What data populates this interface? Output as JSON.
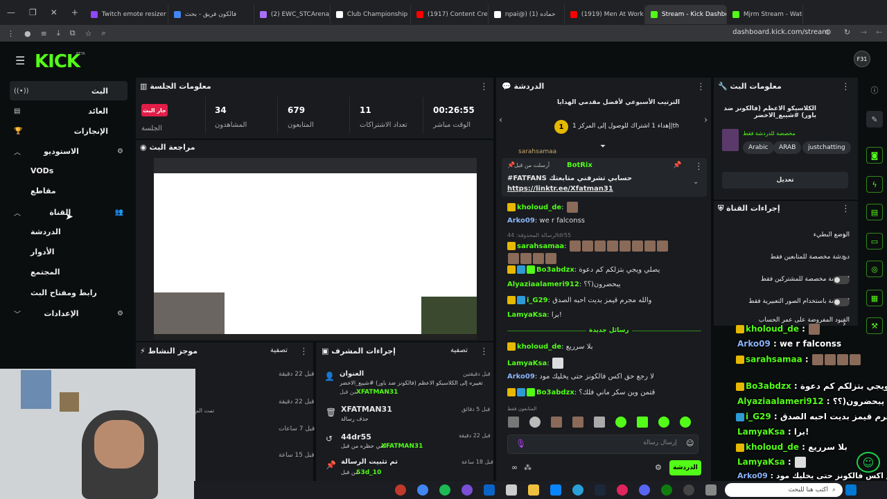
{
  "browser": {
    "tabs": [
      {
        "label": "Twitch emote resizer",
        "color": "#9146ff"
      },
      {
        "label": "فالكون فريق - بحث",
        "color": "#4285f4"
      },
      {
        "label": "(2) EWC_STCArena_A",
        "color": "#a970ff"
      },
      {
        "label": "Club Championship",
        "color": "#ffffff"
      },
      {
        "label": "(1917) Content Creati",
        "color": "#ff0000"
      },
      {
        "label": "npai@) (1) حماده",
        "color": "#ffffff"
      },
      {
        "label": "(1919) Men At Work",
        "color": "#ff0000"
      },
      {
        "label": "Stream - Kick Dashbo",
        "color": "#53fc18"
      },
      {
        "label": "Mjrm Stream - Watc",
        "color": "#53fc18"
      }
    ],
    "url": "dashboard.kick.com/stream"
  },
  "header": {
    "logo": "KICK",
    "logo_sup": "BETA",
    "avatar": "F31"
  },
  "sidebar": {
    "items": [
      {
        "label": "البث"
      },
      {
        "label": "العائد"
      },
      {
        "label": "الإنجازات"
      },
      {
        "label": "الاستوديو"
      },
      {
        "label": "VODs"
      },
      {
        "label": "مقاطع"
      },
      {
        "label": "القناة"
      },
      {
        "label": "الدردشة"
      },
      {
        "label": "الأدوار"
      },
      {
        "label": "المجتمع"
      },
      {
        "label": "رابط ومفتاح البث"
      },
      {
        "label": "الإعدادات"
      }
    ]
  },
  "session": {
    "title": "معلومات الجلسة",
    "live_badge": "جار البث",
    "session_label": "الجلسة",
    "stats": [
      {
        "value": "34",
        "label": "المشاهدون"
      },
      {
        "value": "679",
        "label": "المتابعون"
      },
      {
        "value": "11",
        "label": "تعداد الاشتراكات"
      },
      {
        "value": "00:26:55",
        "label": "الوقت مباشر"
      }
    ]
  },
  "preview": {
    "title": "مراجعة البث"
  },
  "activity": {
    "title": "موجز النشاط",
    "filter": "تصفية",
    "times": [
      "قبل 22 دقيقة",
      "قبل 22 دقيقة",
      "قبل 7 ساعات",
      "قبل 15 ساعة"
    ],
    "snippet": "تمت الم"
  },
  "modlog": {
    "title": "إجراءات المشرف",
    "filter": "تصفية",
    "items": [
      {
        "title": "العنوان",
        "desc": "تم تغييره إلى الكلاسيكو الاعظم (فالكونز ضد باور) #شيبع_الاخضر",
        "by": "XFATMAN31",
        "suffix": "من قبل",
        "time": "قبل دقيقتين"
      },
      {
        "title": "XFATMAN31",
        "desc": "حذف رسالة",
        "time": "قبل 5 دقائق"
      },
      {
        "title": "44dr55",
        "desc": "الغي حظره من قبل",
        "by": "XFATMAN31",
        "time": "قبل 22 دقيقة"
      },
      {
        "title": "تم تثبيت الرسالة",
        "desc": "من قبل",
        "by": "S3d_10",
        "time": "قبل 18 ساعة"
      }
    ]
  },
  "chat": {
    "title": "الدردشة",
    "leaderboard_title": "الترتيب الأسبوعي لأفضل مقدمي الهدايا",
    "leaderboard_rank": "1",
    "leaderboard_text": "إهداء 1 اشتراك للوصول إلى المركز 1|th",
    "pinned_by": "أرسلت من قبل",
    "pinned_user": "BotRix",
    "pinned_text": "#FATFANS حسابي تشرفني متابعتك",
    "pinned_link": "https://linktr.ee/Xfatman31",
    "top_user": "sarahsamaa",
    "messages": [
      {
        "user": "kholoud_de",
        "color": "#53fc18",
        "text": ""
      },
      {
        "user": "Arko09",
        "color": "#8ab4f8",
        "text": "we r falconss"
      },
      {
        "user": "sarahsamaa",
        "color": "#53fc18",
        "text": ""
      },
      {
        "user": "Bo3abdzx",
        "color": "#53fc18",
        "text": "يصلي ويجي بتزلكم كم دعوة"
      },
      {
        "user": "Alyaziaalameri912",
        "color": "#53fc18",
        "text": "يبحضرون(؟؟"
      },
      {
        "user": "i_G29",
        "color": "#53fc18",
        "text": "والله مجرم قيمز بديت احبه الصدق"
      },
      {
        "user": "LamyaKsa",
        "color": "#53fc18",
        "text": "برا!"
      },
      {
        "user": "kholoud_de",
        "color": "#53fc18",
        "text": "بلا سرريع"
      },
      {
        "user": "LamyaKsa",
        "color": "#53fc18",
        "text": ""
      },
      {
        "user": "Arko09",
        "color": "#8ab4f8",
        "text": "لا رجع حق اكس فالكونز حتى يخليك مود"
      },
      {
        "user": "Bo3abdzx",
        "color": "#53fc18",
        "text": "قتمن وين سكر ماني فلك؟"
      }
    ],
    "deleted_text": "الرسالة المحذوفة: 44dr55",
    "new_messages": "رسائل جديدة",
    "followers_only": "المتابعون فقط",
    "input_placeholder": "إرسال رسالة",
    "send_label": "الدردشة"
  },
  "stream_info": {
    "title_label": "معلومات البث",
    "stream_title": "الكلاسيكو الاعظم (فالكونز ضد باور) #شيبع_الاخضر",
    "category_link": "مخصصة للدردشة فقط",
    "tags": [
      "Arabic",
      "ARAB",
      "justchatting"
    ],
    "edit": "تعديل"
  },
  "channel_actions": {
    "title": "إجراءات القناة",
    "rows": [
      {
        "label": "الوضع البطيء",
        "kind": "chevron"
      },
      {
        "label": "دردشة مخصصة للمتابعين فقط",
        "kind": "chevron"
      },
      {
        "label": "الدردشة مخصصة للمشتركين فقط",
        "kind": "toggle"
      },
      {
        "label": "الدردشة باستخدام الصور التعبيرية فقط",
        "kind": "toggle"
      },
      {
        "label": "القيود المفروضة على عمر الحساب",
        "kind": "chevron"
      }
    ]
  },
  "overlay_chat": [
    {
      "user": "kholoud_de",
      "text": ""
    },
    {
      "user": "Arko09",
      "text": "we r falconss"
    },
    {
      "user": "sarahsamaa",
      "text": ""
    },
    {
      "user": "Bo3abdzx",
      "text": "يصلي ويجي بتزلكم كم دعوة"
    },
    {
      "user": "Alyaziaalameri912",
      "text": "يبحضرون(؟؟"
    },
    {
      "user": "i_G29",
      "text": "والله مجرم قيمز بديت احبه الصدق"
    },
    {
      "user": "LamyaKsa",
      "text": "برا!"
    },
    {
      "user": "kholoud_de",
      "text": "بلا سرريع"
    },
    {
      "user": "LamyaKsa",
      "text": ""
    },
    {
      "user": "Arko09",
      "text": "لا رجع حق اكس فالكونز حتى يخليك مود"
    }
  ],
  "taskbar": {
    "search_placeholder": "اكتب هنا للبحث"
  },
  "colors": {
    "kick_green": "#53fc18",
    "bg": "#0b0e0f",
    "panel": "#191b1f"
  }
}
